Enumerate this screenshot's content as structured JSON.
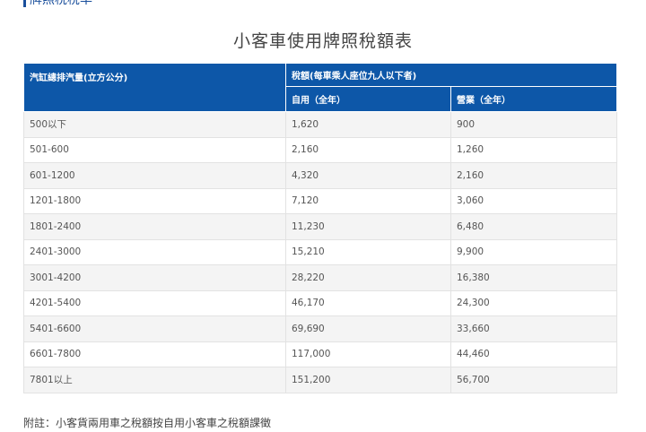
{
  "section_heading": "牌照稅稅率",
  "title": "小客車使用牌照稅額表",
  "table": {
    "header": {
      "displacement": "汽缸總排汽量(立方公分)",
      "tax_group": "稅額(每車乘人座位九人以下者)",
      "private": "自用（全年）",
      "commercial": "營業（全年）"
    },
    "rows": [
      {
        "range": "500以下",
        "private": "1,620",
        "commercial": "900"
      },
      {
        "range": "501-600",
        "private": "2,160",
        "commercial": "1,260"
      },
      {
        "range": "601-1200",
        "private": "4,320",
        "commercial": "2,160"
      },
      {
        "range": "1201-1800",
        "private": "7,120",
        "commercial": "3,060"
      },
      {
        "range": "1801-2400",
        "private": "11,230",
        "commercial": "6,480"
      },
      {
        "range": "2401-3000",
        "private": "15,210",
        "commercial": "9,900"
      },
      {
        "range": "3001-4200",
        "private": "28,220",
        "commercial": "16,380"
      },
      {
        "range": "4201-5400",
        "private": "46,170",
        "commercial": "24,300"
      },
      {
        "range": "5401-6600",
        "private": "69,690",
        "commercial": "33,660"
      },
      {
        "range": "6601-7800",
        "private": "117,000",
        "commercial": "44,460"
      },
      {
        "range": "7801以上",
        "private": "151,200",
        "commercial": "56,700"
      }
    ]
  },
  "footnote": "附註：小客貨兩用車之稅額按自用小客車之稅額課徵"
}
